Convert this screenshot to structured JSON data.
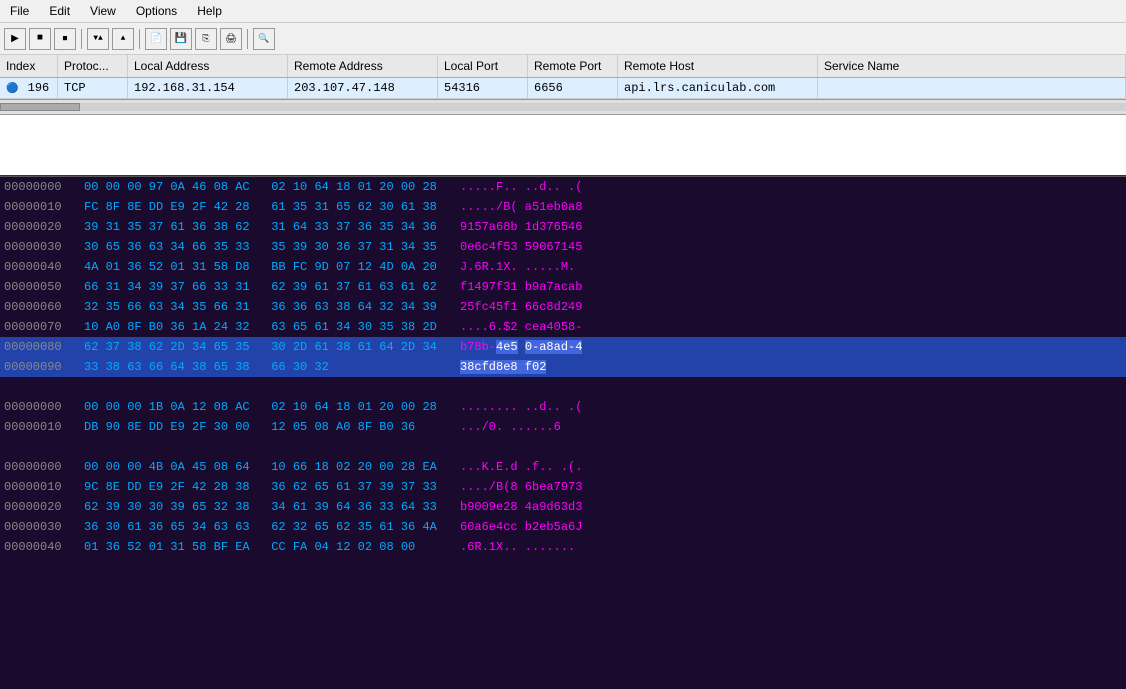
{
  "menubar": {
    "items": [
      "File",
      "Edit",
      "View",
      "Options",
      "Help"
    ]
  },
  "toolbar": {
    "buttons": [
      "▶",
      "■",
      "⏹",
      "▼▲",
      "▲",
      "☐",
      "⎘",
      "⎙",
      "⊞",
      "◎"
    ]
  },
  "table": {
    "columns": [
      "Index",
      "Protoc...",
      "Local Address",
      "Remote Address",
      "Local Port",
      "Remote Port",
      "Remote Host",
      "Service Name"
    ],
    "rows": [
      {
        "icon": "🔵",
        "index": "196",
        "protocol": "TCP",
        "local_address": "192.168.31.154",
        "remote_address": "203.107.47.148",
        "local_port": "54316",
        "remote_port": "6656",
        "remote_host": "api.lrs.caniculab.com",
        "service_name": ""
      }
    ]
  },
  "hex_sections": [
    {
      "rows": [
        {
          "offset": "00000000",
          "bytes": "00 00 00 97 0A 46 08 AC   02 10 64 18 01 20 00 28",
          "ascii": ".....F.. ..d.. .(",
          "selected": false,
          "highlight_bytes": null,
          "highlight_ascii": null
        },
        {
          "offset": "00000010",
          "bytes": "FC 8F 8E DD E9 2F 42 28   61 35 31 65 62 30 61 38",
          "ascii": "...../B( a51eb0a8",
          "selected": false,
          "highlight_bytes": null,
          "highlight_ascii": null
        },
        {
          "offset": "00000020",
          "bytes": "39 31 35 37 61 36 38 62   31 64 33 37 36 35 34 36",
          "ascii": "9157a68b 1d376546",
          "selected": false,
          "highlight_bytes": null,
          "highlight_ascii": null
        },
        {
          "offset": "00000030",
          "bytes": "30 65 36 63 34 66 35 33   35 39 30 36 37 31 34 35",
          "ascii": "0e6c4f53 59067145",
          "selected": false,
          "highlight_bytes": null,
          "highlight_ascii": null
        },
        {
          "offset": "00000040",
          "bytes": "4A 01 36 52 01 31 58 D8   BB FC 9D 07 12 4D 0A 20",
          "ascii": "J.6R.1X. .....M.",
          "selected": false,
          "highlight_bytes": null,
          "highlight_ascii": null
        },
        {
          "offset": "00000050",
          "bytes": "66 31 34 39 37 66 33 31   62 39 61 37 61 63 61 62",
          "ascii": "f1497f31 b9a7acab",
          "selected": false,
          "highlight_bytes": null,
          "highlight_ascii": null
        },
        {
          "offset": "00000060",
          "bytes": "32 35 66 63 34 35 66 31   36 36 63 38 64 32 34 39",
          "ascii": "25fc45f1 66c8d249",
          "selected": false,
          "highlight_bytes": null,
          "highlight_ascii": null
        },
        {
          "offset": "00000070",
          "bytes": "10 A0 8F B0 36 1A 24 32   63 65 61 34 30 35 38 2D",
          "ascii": "....6.$2 cea4058-",
          "selected": false,
          "highlight_bytes": null,
          "highlight_ascii": null
        },
        {
          "offset": "00000080",
          "bytes": "62 37 38 62 2D 34 65 35   30 2D 61 38 61 64 2D 34",
          "ascii": "b78b-4e5 0-a8ad-4",
          "selected": true,
          "highlight_bytes": "4e5",
          "highlight_ascii": "4e5 0-a8ad-4"
        },
        {
          "offset": "00000090",
          "bytes": "33 38 63 66 64 38 65 38   66 30 32",
          "ascii": "38cfd8e8 f02",
          "selected": true,
          "highlight_bytes": null,
          "highlight_ascii": null
        }
      ]
    },
    {
      "rows": [
        {
          "offset": "00000000",
          "bytes": "00 00 00 1B 0A 12 08 AC   02 10 64 18 01 20 00 28",
          "ascii": "........ ..d.. .(",
          "selected": false
        },
        {
          "offset": "00000010",
          "bytes": "DB 90 8E DD E9 2F 30 00   12 05 08 A0 8F B0 36",
          "ascii": ".../0. ......6",
          "selected": false
        }
      ]
    },
    {
      "rows": [
        {
          "offset": "00000000",
          "bytes": "00 00 00 4B 0A 45 08 64   10 66 18 02 20 00 28 EA",
          "ascii": "...K.E.d .f.. .(.",
          "selected": false
        },
        {
          "offset": "00000010",
          "bytes": "9C 8E DD E9 2F 42 28 38   36 62 65 61 37 39 37 33",
          "ascii": "..../B(8 6bea7973",
          "selected": false
        },
        {
          "offset": "00000020",
          "bytes": "62 39 30 30 39 65 32 38   34 61 39 64 36 33 64 33",
          "ascii": "b9009e28 4a9d63d3",
          "selected": false
        },
        {
          "offset": "00000030",
          "bytes": "36 30 61 36 65 34 63 63   62 32 65 62 35 61 36 4A",
          "ascii": "60a6e4cc b2eb5a6J",
          "selected": false
        },
        {
          "offset": "00000040",
          "bytes": "01 36 52 01 31 58 BF EA   CC FA 04 12 02 08 00",
          "ascii": ".6R.1X.. .......",
          "selected": false
        }
      ]
    }
  ]
}
